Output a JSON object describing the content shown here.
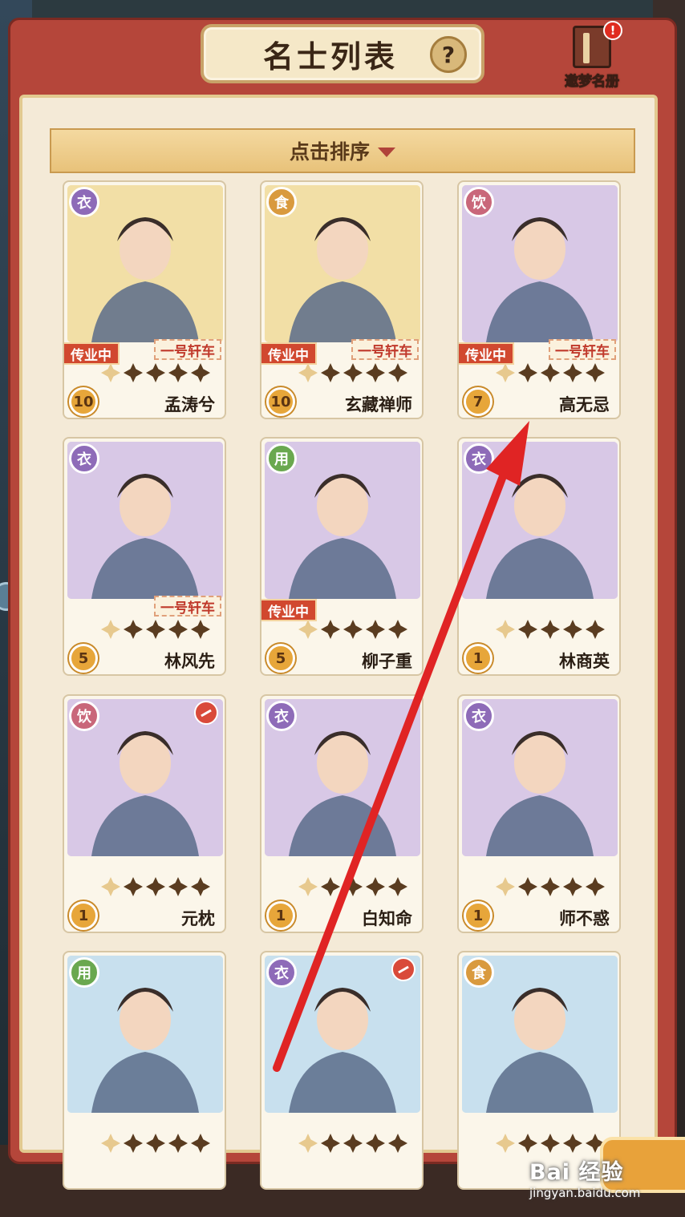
{
  "header": {
    "title": "名士列表",
    "help_icon": "?",
    "dream_book_label": "邀梦名册",
    "dream_book_badge": "!"
  },
  "sort_bar": {
    "label": "点击排序"
  },
  "tags": {
    "training": "传业中",
    "carriage": "一号轩车"
  },
  "cards": [
    {
      "type": "衣",
      "type_color": "#8e6bb8",
      "name": "孟涛兮",
      "level": "10",
      "training": true,
      "carriage": true,
      "stars_filled": 4,
      "corner_badge": false,
      "bg": "#f2dfa6"
    },
    {
      "type": "食",
      "type_color": "#d99a3e",
      "name": "玄藏禅师",
      "level": "10",
      "training": true,
      "carriage": true,
      "stars_filled": 4,
      "corner_badge": false,
      "bg": "#f2dfa6"
    },
    {
      "type": "饮",
      "type_color": "#c9677a",
      "name": "高无忌",
      "level": "7",
      "training": true,
      "carriage": true,
      "stars_filled": 4,
      "corner_badge": false,
      "bg": "#d8c8e6"
    },
    {
      "type": "衣",
      "type_color": "#8e6bb8",
      "name": "林风先",
      "level": "5",
      "training": false,
      "carriage": true,
      "stars_filled": 4,
      "corner_badge": false,
      "bg": "#d8c8e6"
    },
    {
      "type": "用",
      "type_color": "#6aa84f",
      "name": "柳子重",
      "level": "5",
      "training": true,
      "carriage": false,
      "stars_filled": 4,
      "corner_badge": false,
      "bg": "#d8c8e6"
    },
    {
      "type": "衣",
      "type_color": "#8e6bb8",
      "name": "林商英",
      "level": "1",
      "training": false,
      "carriage": false,
      "stars_filled": 4,
      "corner_badge": false,
      "bg": "#d8c8e6"
    },
    {
      "type": "饮",
      "type_color": "#c9677a",
      "name": "元枕",
      "level": "1",
      "training": false,
      "carriage": false,
      "stars_filled": 4,
      "corner_badge": true,
      "bg": "#d8c8e6"
    },
    {
      "type": "衣",
      "type_color": "#8e6bb8",
      "name": "白知命",
      "level": "1",
      "training": false,
      "carriage": false,
      "stars_filled": 4,
      "corner_badge": false,
      "bg": "#d8c8e6"
    },
    {
      "type": "衣",
      "type_color": "#8e6bb8",
      "name": "师不惑",
      "level": "1",
      "training": false,
      "carriage": false,
      "stars_filled": 4,
      "corner_badge": false,
      "bg": "#d8c8e6"
    },
    {
      "type": "用",
      "type_color": "#6aa84f",
      "name": "",
      "level": "",
      "training": false,
      "carriage": false,
      "stars_filled": 4,
      "corner_badge": false,
      "bg": "#c8e0ee"
    },
    {
      "type": "衣",
      "type_color": "#8e6bb8",
      "name": "",
      "level": "",
      "training": false,
      "carriage": false,
      "stars_filled": 4,
      "corner_badge": true,
      "bg": "#c8e0ee"
    },
    {
      "type": "食",
      "type_color": "#d99a3e",
      "name": "",
      "level": "",
      "training": false,
      "carriage": false,
      "stars_filled": 4,
      "corner_badge": false,
      "bg": "#c8e0ee"
    }
  ],
  "watermark": {
    "main": "Bai 经验",
    "sub": "jingyan.baidu.com"
  }
}
